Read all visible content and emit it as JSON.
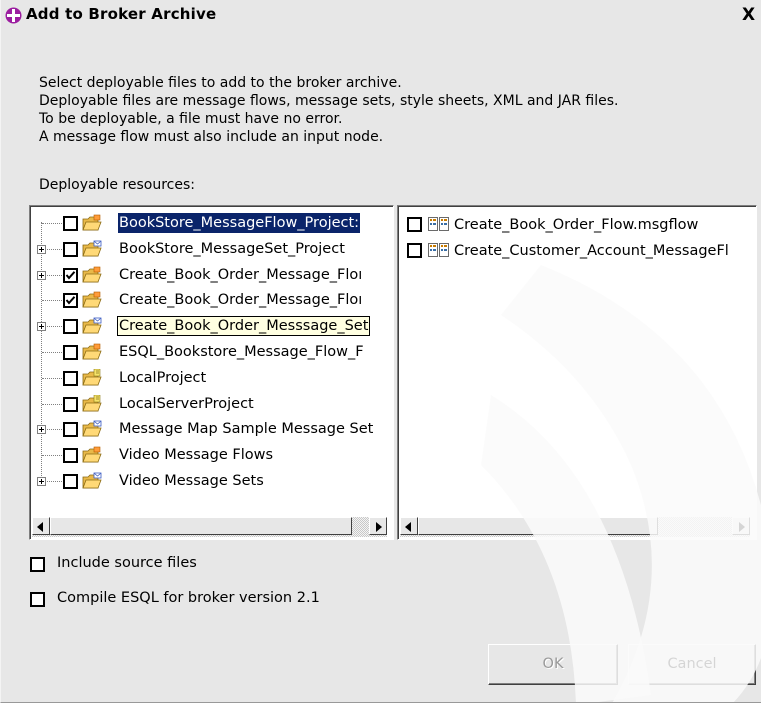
{
  "dialog": {
    "title": "Add to Broker Archive",
    "close_glyph": "X"
  },
  "description": [
    "Select deployable files to add to the broker archive.",
    "Deployable files are message flows, message sets, style sheets, XML and JAR files.",
    "To be deployable, a file must have no error.",
    "A message flow must also include an input node."
  ],
  "resources_label": "Deployable resources:",
  "projects": [
    {
      "label": "BookStore_MessageFlow_Project",
      "display": "BookStore_MessageFlow_Project:",
      "checked": false,
      "expandable": false,
      "state": "selected",
      "icon": "folder-flow-icon"
    },
    {
      "label": "BookStore_MessageSet_Project",
      "display": "BookStore_MessageSet_Project",
      "checked": false,
      "expandable": true,
      "state": "normal",
      "icon": "folder-set-icon"
    },
    {
      "label": "Create_Book_Order_Message_Flow",
      "display": "Create_Book_Order_Message_Floı",
      "checked": true,
      "expandable": true,
      "state": "normal",
      "icon": "folder-flow-icon"
    },
    {
      "label": "Create_Book_Order_Message_Flow",
      "display": "Create_Book_Order_Message_Floı",
      "checked": true,
      "expandable": false,
      "state": "normal",
      "icon": "folder-flow-icon"
    },
    {
      "label": "Create_Book_Order_Messsage_Set",
      "display": "Create_Book_Order_Messsage_Set",
      "checked": false,
      "expandable": true,
      "state": "tooltip",
      "icon": "folder-set-icon"
    },
    {
      "label": "ESQL_Bookstore_Message_Flow_Project",
      "display": "ESQL_Bookstore_Message_Flow_F",
      "checked": false,
      "expandable": false,
      "state": "normal",
      "icon": "folder-flow-icon"
    },
    {
      "label": "LocalProject",
      "display": "LocalProject",
      "checked": false,
      "expandable": false,
      "state": "normal",
      "icon": "folder-java-icon"
    },
    {
      "label": "LocalServerProject",
      "display": "LocalServerProject",
      "checked": false,
      "expandable": false,
      "state": "normal",
      "icon": "folder-java-icon"
    },
    {
      "label": "Message Map Sample Message Set",
      "display": "Message Map Sample Message Set",
      "checked": false,
      "expandable": true,
      "state": "normal",
      "icon": "folder-set-icon"
    },
    {
      "label": "Video Message Flows",
      "display": "Video Message Flows",
      "checked": false,
      "expandable": false,
      "state": "normal",
      "icon": "folder-flow-icon"
    },
    {
      "label": "Video Message Sets",
      "display": "Video Message Sets",
      "checked": false,
      "expandable": true,
      "state": "normal",
      "icon": "folder-set-icon"
    }
  ],
  "files": [
    {
      "label": "Create_Book_Order_Flow.msgflow",
      "checked": false,
      "icon": "msgflow-icon"
    },
    {
      "label": "Create_Customer_Account_MessageFl",
      "checked": false,
      "icon": "msgflow-icon"
    }
  ],
  "options": {
    "include_source": {
      "label": "Include source files",
      "checked": false
    },
    "compile_esql": {
      "label": "Compile ESQL for broker version 2.1",
      "checked": false
    }
  },
  "buttons": {
    "ok": {
      "label": "OK",
      "enabled": false
    },
    "cancel": {
      "label": "Cancel",
      "enabled": true
    }
  },
  "colors": {
    "selection": "#0a246a",
    "tooltip": "#ffffe1",
    "dialog_bg": "#e7e7e7",
    "title_icon": "#9b1ea0"
  }
}
